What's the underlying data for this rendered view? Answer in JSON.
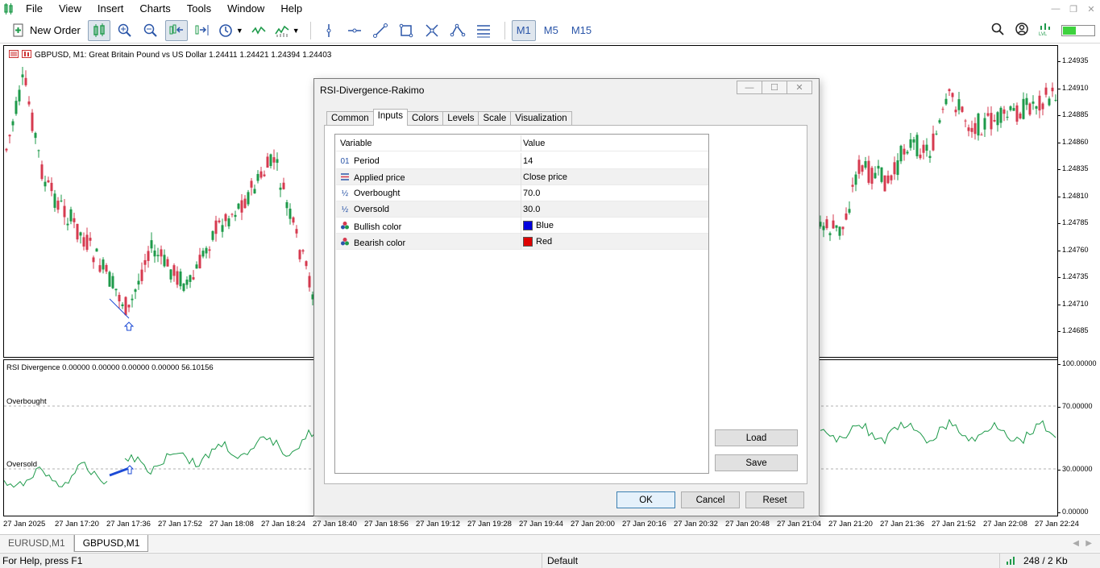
{
  "menu": [
    "File",
    "View",
    "Insert",
    "Charts",
    "Tools",
    "Window",
    "Help"
  ],
  "toolbar": {
    "new_order_label": "New Order",
    "timeframes": [
      "M1",
      "M5",
      "M15"
    ],
    "active_timeframe": "M1"
  },
  "chart": {
    "symbol_label": "GBPUSD, M1:  Great Britain Pound vs US Dollar  1.24411 1.24421 1.24394 1.24403",
    "price_labels": [
      "1.24935",
      "1.24910",
      "1.24885",
      "1.24860",
      "1.24835",
      "1.24810",
      "1.24785",
      "1.24760",
      "1.24735",
      "1.24710",
      "1.24685"
    ],
    "colors": {
      "bull": "#1e9a4a",
      "bear": "#d63a4f",
      "arrow": "#1d4bd6"
    }
  },
  "indicator": {
    "title": "RSI Divergence 0.00000 0.00000 0.00000 0.00000 56.10156",
    "overbought_label": "Overbought",
    "oversold_label": "Oversold",
    "axis_labels": [
      "100.00000",
      "70.00000",
      "30.00000",
      "0.00000"
    ]
  },
  "time_axis": [
    "27 Jan 2025",
    "27 Jan 17:20",
    "27 Jan 17:36",
    "27 Jan 17:52",
    "27 Jan 18:08",
    "27 Jan 18:24",
    "27 Jan 18:40",
    "27 Jan 18:56",
    "27 Jan 19:12",
    "27 Jan 19:28",
    "27 Jan 19:44",
    "27 Jan 20:00",
    "27 Jan 20:16",
    "27 Jan 20:32",
    "27 Jan 20:48",
    "27 Jan 21:04",
    "27 Jan 21:20",
    "27 Jan 21:36",
    "27 Jan 21:52",
    "27 Jan 22:08",
    "27 Jan 22:24"
  ],
  "chart_tabs": [
    "EURUSD,M1",
    "GBPUSD,M1"
  ],
  "active_chart_tab": "GBPUSD,M1",
  "status": {
    "help": "For Help, press F1",
    "profile": "Default",
    "traffic": "248 / 2 Kb"
  },
  "dialog": {
    "title": "RSI-Divergence-Rakimo",
    "tabs": [
      "Common",
      "Inputs",
      "Colors",
      "Levels",
      "Scale",
      "Visualization"
    ],
    "active_tab": "Inputs",
    "grid_headers": {
      "variable": "Variable",
      "value": "Value"
    },
    "inputs": [
      {
        "icon": "01",
        "name": "Period",
        "value": "14"
      },
      {
        "icon": "list",
        "name": "Applied price",
        "value": "Close price"
      },
      {
        "icon": "½",
        "name": "Overbought",
        "value": "70.0"
      },
      {
        "icon": "½",
        "name": "Oversold",
        "value": "30.0"
      },
      {
        "icon": "palette",
        "name": "Bullish color",
        "value": "Blue",
        "swatch": "#0000dd"
      },
      {
        "icon": "palette",
        "name": "Bearish color",
        "value": "Red",
        "swatch": "#dd0000"
      }
    ],
    "buttons": {
      "load": "Load",
      "save": "Save",
      "ok": "OK",
      "cancel": "Cancel",
      "reset": "Reset"
    }
  }
}
